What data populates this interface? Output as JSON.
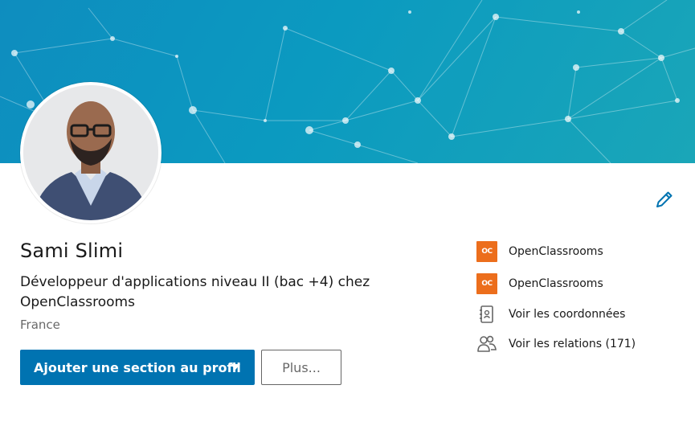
{
  "profile": {
    "name": "Sami Slimi",
    "headline": "Développeur d'applications niveau II (bac +4) chez OpenClassrooms",
    "location": "France"
  },
  "actions": {
    "add_section_label": "Ajouter une section au profil",
    "more_label": "Plus..."
  },
  "sidebar": {
    "items": [
      {
        "label": "OpenClassrooms",
        "icon": "openclassrooms-logo"
      },
      {
        "label": "OpenClassrooms",
        "icon": "openclassrooms-logo"
      },
      {
        "label": "Voir les coordonnées",
        "icon": "contact-card-icon"
      },
      {
        "label": "Voir les relations (171)",
        "icon": "people-icon"
      }
    ]
  },
  "colors": {
    "primary": "#0073b1",
    "banner": "#0e8dbf",
    "openclassrooms": "#ec6e1c"
  },
  "icons": {
    "edit": "pencil-icon"
  }
}
